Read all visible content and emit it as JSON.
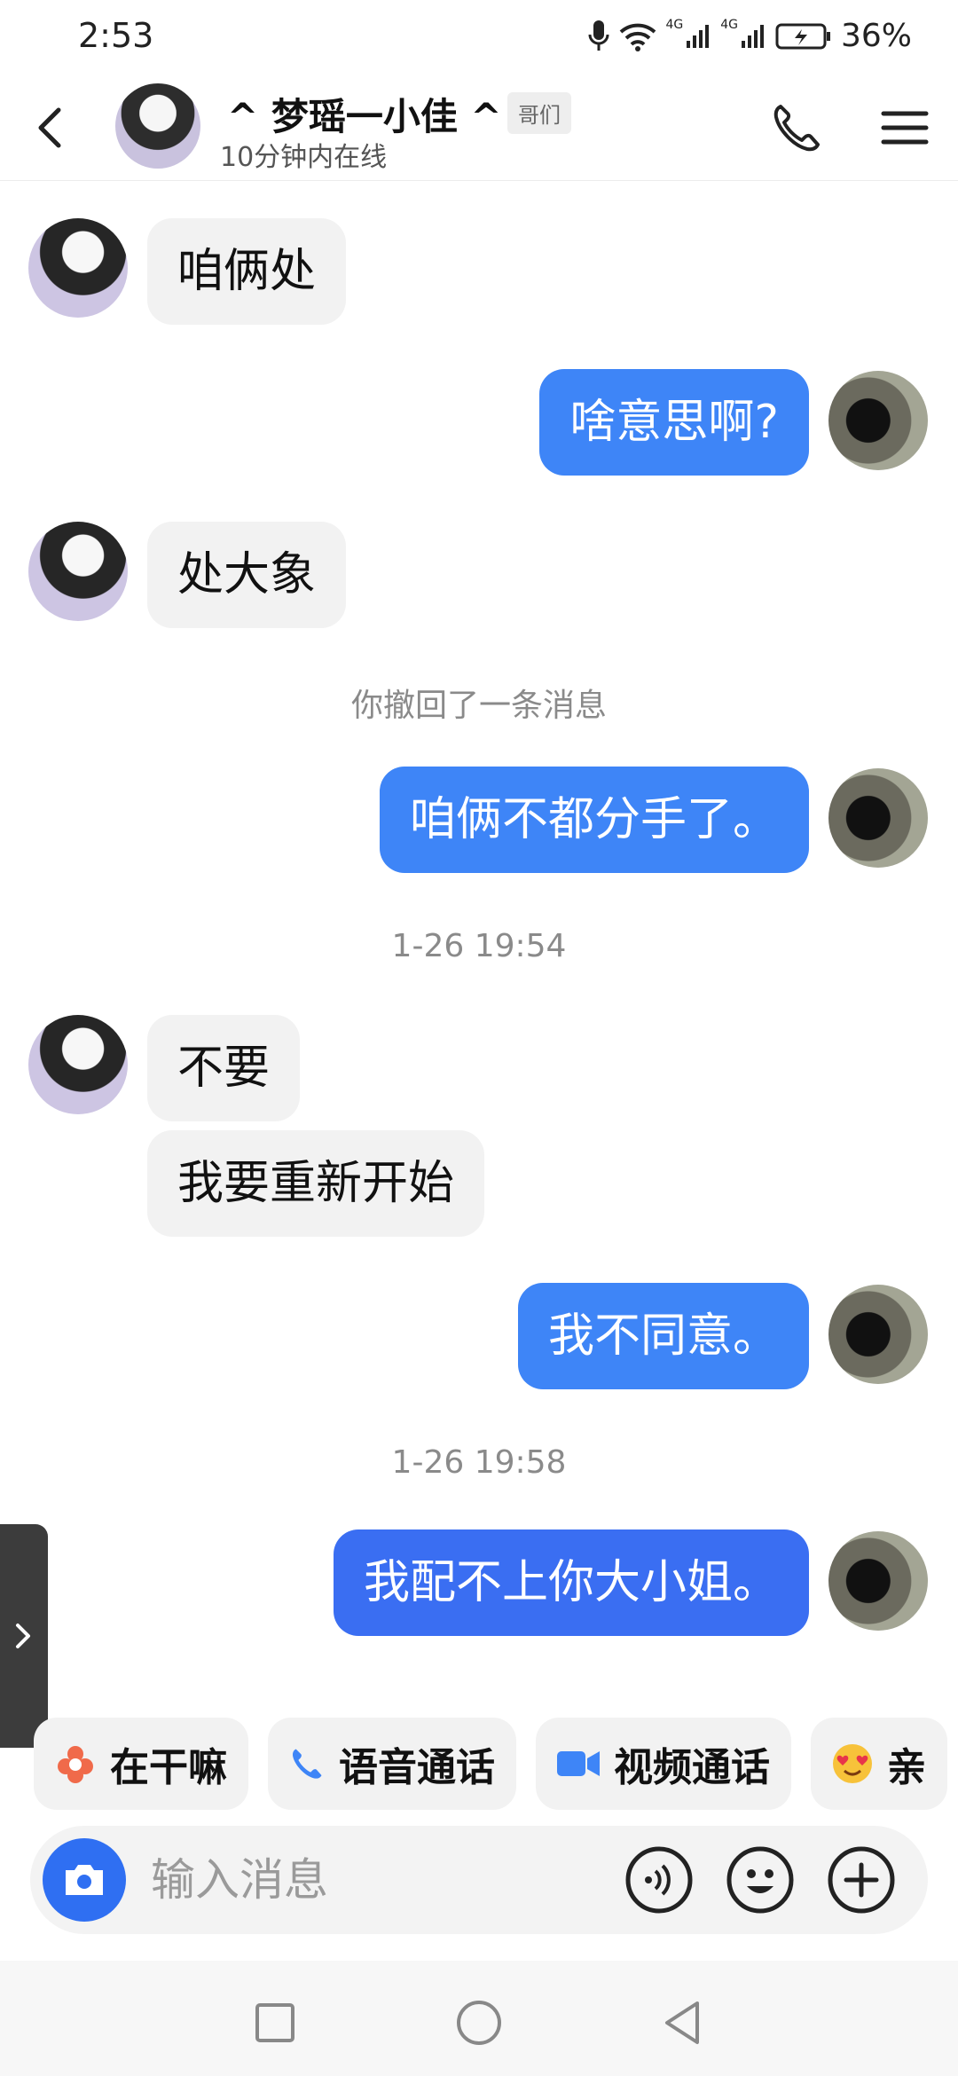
{
  "status": {
    "time": "2:53",
    "signal1": "4G",
    "signal2": "4G",
    "battery": "36%"
  },
  "header": {
    "name": "^ 梦瑶一小佳 ^",
    "tag": "哥们",
    "online": "10分钟内在线"
  },
  "messages": {
    "m1": "咱俩处",
    "m2": "啥意思啊?",
    "m3": "处大象",
    "note1": "你撤回了一条消息",
    "m4": "咱俩不都分手了。",
    "time1": "1-26 19:54",
    "m5": "不要",
    "m6": "我要重新开始",
    "m7": "我不同意。",
    "time2": "1-26 19:58",
    "m8": "我配不上你大小姐。"
  },
  "quick_actions": {
    "a1": "在干嘛",
    "a2": "语音通话",
    "a3": "视频通话",
    "a4": "亲"
  },
  "input": {
    "placeholder": "输入消息"
  },
  "colors": {
    "out_bubble": "#3e85f7",
    "in_bubble": "#f2f2f2",
    "camera": "#2f6ff2"
  }
}
